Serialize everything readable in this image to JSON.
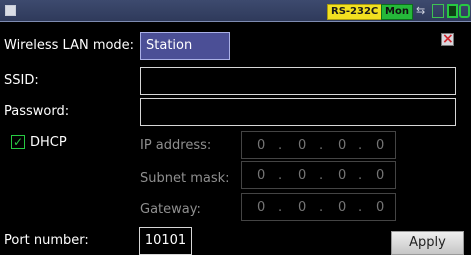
{
  "topbar": {
    "rs_badge": "RS-232C",
    "mon_badge": "Mon",
    "usb_icon": "usb-icon",
    "lan_icon": "lan-icon",
    "sd_icon": "sd-card-icon",
    "battery_icon": "battery-icon"
  },
  "close": {
    "icon": "close-icon",
    "glyph": "×"
  },
  "wireless": {
    "label": "Wireless LAN mode:",
    "value": "Station"
  },
  "ssid": {
    "label": "SSID:",
    "value": ""
  },
  "password": {
    "label": "Password:",
    "value": ""
  },
  "dhcp": {
    "label": "DHCP",
    "checked": true,
    "check_glyph": "✓"
  },
  "ip": {
    "label": "IP address:",
    "octets": [
      "0",
      ".",
      "0",
      ".",
      "0",
      ".",
      "0"
    ]
  },
  "subnet": {
    "label": "Subnet mask:",
    "octets": [
      "0",
      ".",
      "0",
      ".",
      "0",
      ".",
      "0"
    ]
  },
  "gateway": {
    "label": "Gateway:",
    "octets": [
      "0",
      ".",
      "0",
      ".",
      "0",
      ".",
      "0"
    ]
  },
  "port": {
    "label": "Port number:",
    "value": "10101"
  },
  "apply": {
    "label": "Apply"
  },
  "colors": {
    "accent": "#27c942",
    "select_bg": "#4b4f96",
    "rs_badge": "#f2e020",
    "mon_badge": "#25b83a"
  }
}
